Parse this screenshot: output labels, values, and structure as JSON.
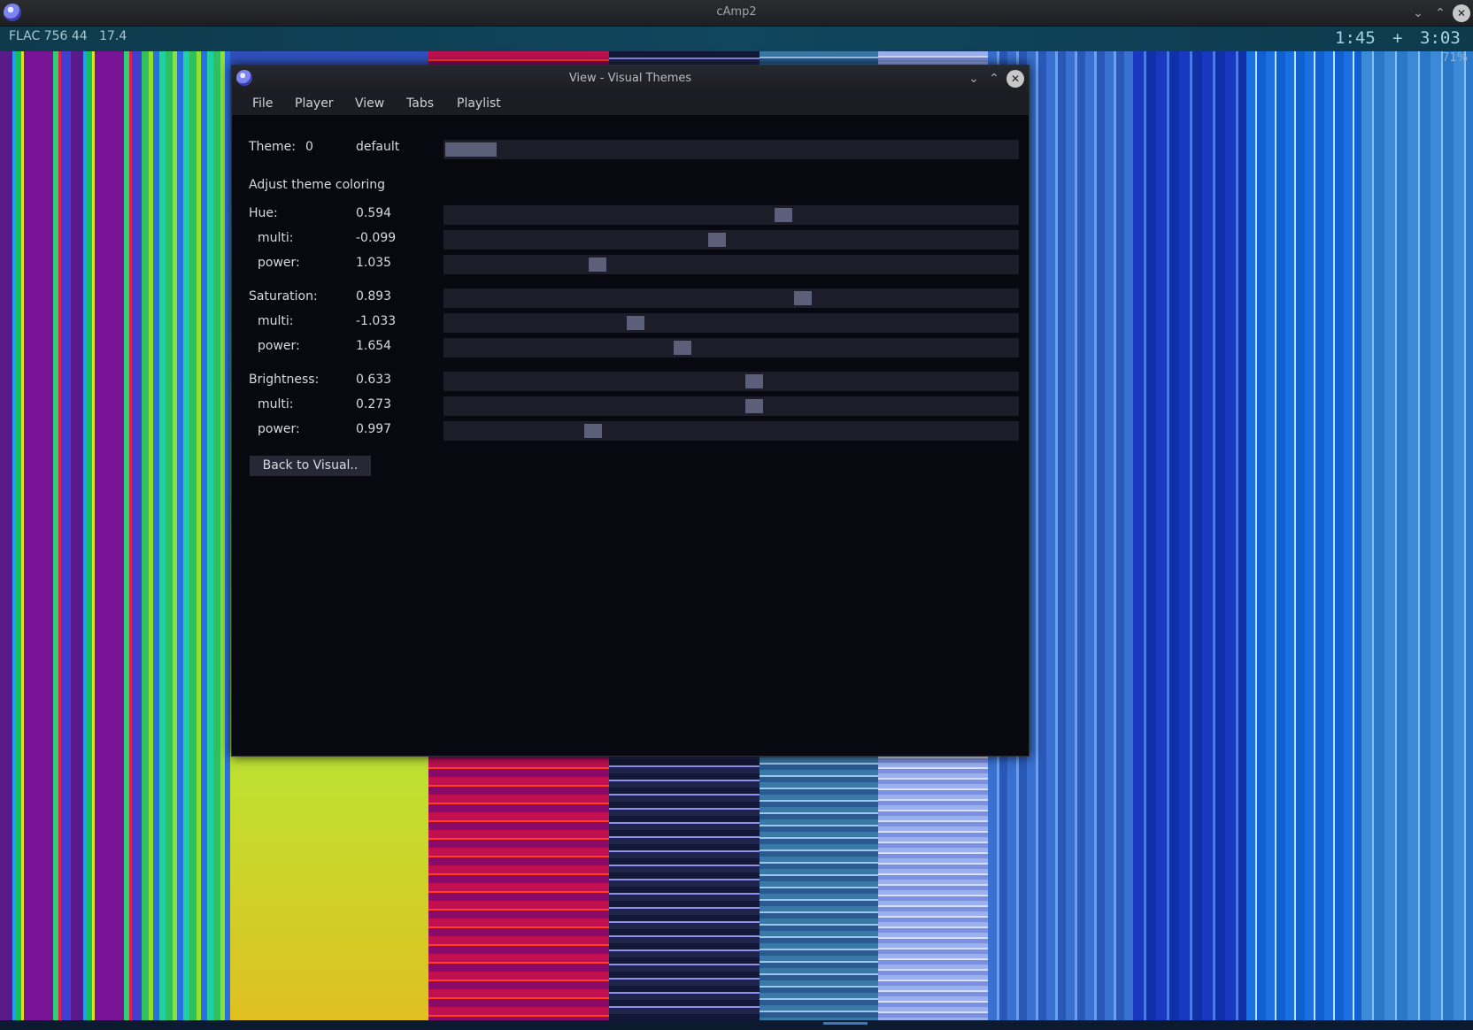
{
  "window": {
    "title": "cAmp2"
  },
  "status": {
    "format_info": "FLAC 756 44   17.4",
    "elapsed": "1:45",
    "separator": "+",
    "total": "3:03",
    "zoom": "71%"
  },
  "dialog": {
    "title": "View - Visual Themes",
    "menu": [
      "File",
      "Player",
      "View",
      "Tabs",
      "Playlist"
    ],
    "theme": {
      "label": "Theme:",
      "number": "0",
      "name": "default",
      "position": 0.0
    },
    "section_heading": "Adjust theme coloring",
    "groups": [
      {
        "label": "Hue:",
        "value": "0.594",
        "position": 0.594
      },
      {
        "label": "multi:",
        "value": "-0.099",
        "position": 0.475
      },
      {
        "label": "power:",
        "value": "1.035",
        "position": 0.26
      },
      {
        "label": "Saturation:",
        "value": "0.893",
        "position": 0.628
      },
      {
        "label": "multi:",
        "value": "-1.033",
        "position": 0.328
      },
      {
        "label": "power:",
        "value": "1.654",
        "position": 0.412
      },
      {
        "label": "Brightness:",
        "value": "0.633",
        "position": 0.541
      },
      {
        "label": "multi:",
        "value": "0.273",
        "position": 0.541
      },
      {
        "label": "power:",
        "value": "0.997",
        "position": 0.253
      }
    ],
    "back_button": "Back to Visual.."
  },
  "colors": {
    "dialog_bg": "#080810",
    "slider_track": "#1c1d28",
    "slider_knob": "#5c5f7a",
    "status_bg": "#10465e"
  }
}
